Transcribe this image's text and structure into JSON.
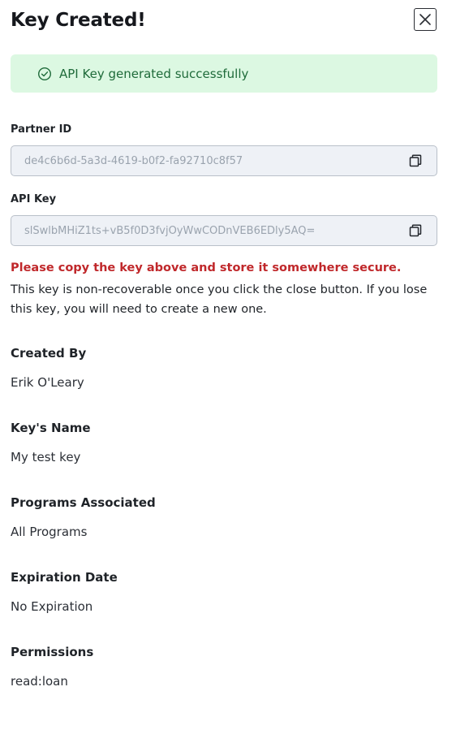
{
  "dialog": {
    "title": "Key Created!",
    "close_icon": "close-icon"
  },
  "banner": {
    "icon": "check-circle-icon",
    "text": "API Key generated successfully",
    "background": "#dcf8e2",
    "text_color": "#1f6b3a"
  },
  "partner_id": {
    "label": "Partner ID",
    "value": "de4c6b6d-5a3d-4619-b0f2-fa92710c8f57",
    "copy_icon": "copy-icon"
  },
  "api_key": {
    "label": "API Key",
    "value": "slSwlbMHiZ1ts+vB5f0D3fvjOyWwCODnVEB6EDly5AQ=",
    "copy_icon": "copy-icon"
  },
  "warning": {
    "title": "Please copy the key above and store it somewhere secure.",
    "text": "This key is non-recoverable once you click the close button. If you lose this key, you will need to create a new one.",
    "color": "#c0282b"
  },
  "details": [
    {
      "label": "Created By",
      "value": "Erik O'Leary"
    },
    {
      "label": "Key's Name",
      "value": "My test key"
    },
    {
      "label": "Programs Associated",
      "value": "All Programs"
    },
    {
      "label": "Expiration Date",
      "value": "No Expiration"
    },
    {
      "label": "Permissions",
      "value": "read:loan"
    }
  ]
}
